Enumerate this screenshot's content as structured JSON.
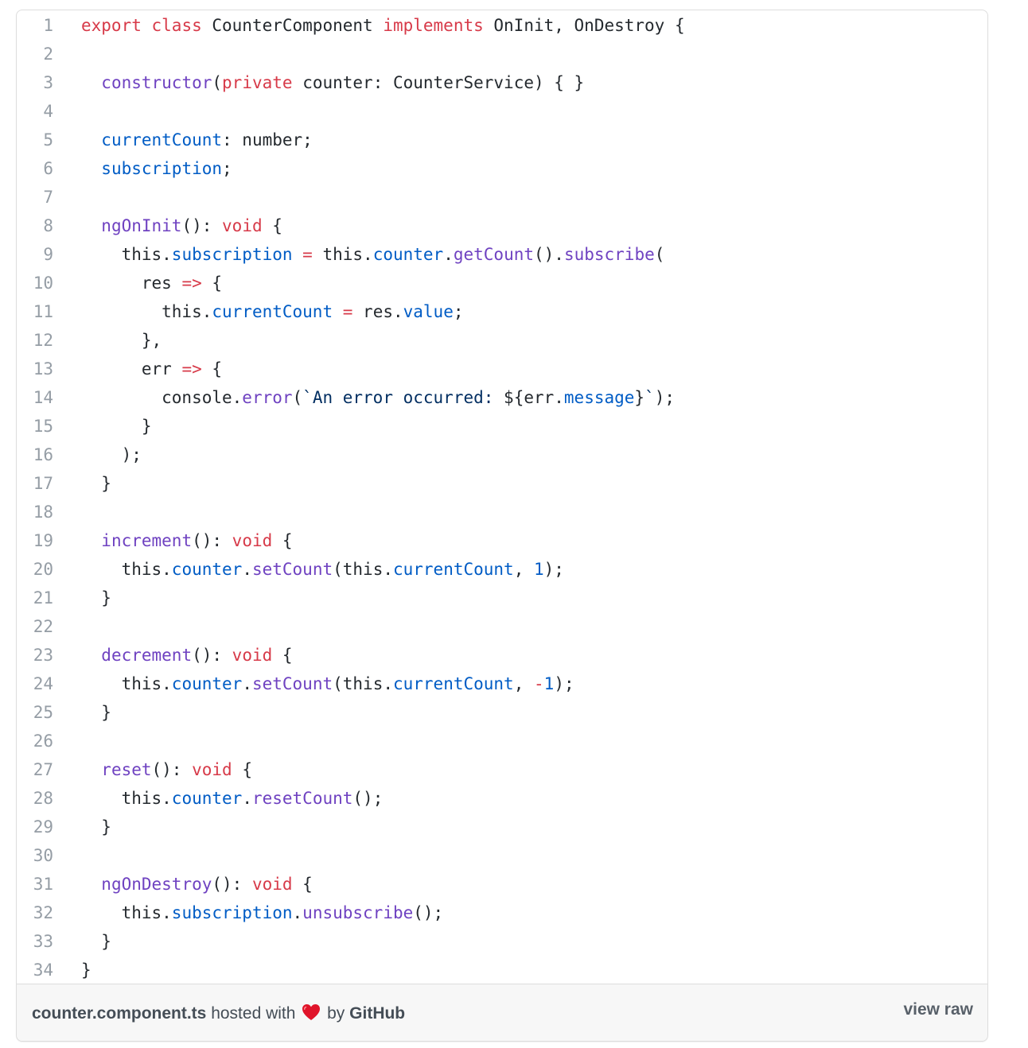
{
  "gist": {
    "filename": "counter.component.ts",
    "hosted_with": "hosted with",
    "by": "by",
    "host": "GitHub",
    "view_raw": "view raw"
  },
  "colors": {
    "keyword": "#d73a49",
    "function": "#6f42c1",
    "property": "#005cc5",
    "string": "#032f62",
    "text": "#24292e",
    "line_number": "#959da5"
  },
  "code_lines": [
    [
      [
        "k",
        "export"
      ],
      [
        "t",
        " "
      ],
      [
        "k",
        "class"
      ],
      [
        "t",
        " CounterComponent "
      ],
      [
        "k",
        "implements"
      ],
      [
        "t",
        " OnInit, OnDestroy {"
      ]
    ],
    [],
    [
      [
        "t",
        "  "
      ],
      [
        "f",
        "constructor"
      ],
      [
        "t",
        "("
      ],
      [
        "k",
        "private"
      ],
      [
        "t",
        " counter: CounterService) { }"
      ]
    ],
    [],
    [
      [
        "t",
        "  "
      ],
      [
        "p",
        "currentCount"
      ],
      [
        "t",
        ": number;"
      ]
    ],
    [
      [
        "t",
        "  "
      ],
      [
        "p",
        "subscription"
      ],
      [
        "t",
        ";"
      ]
    ],
    [],
    [
      [
        "t",
        "  "
      ],
      [
        "f",
        "ngOnInit"
      ],
      [
        "t",
        "(): "
      ],
      [
        "k",
        "void"
      ],
      [
        "t",
        " {"
      ]
    ],
    [
      [
        "t",
        "    this."
      ],
      [
        "p",
        "subscription"
      ],
      [
        "t",
        " "
      ],
      [
        "k",
        "="
      ],
      [
        "t",
        " this."
      ],
      [
        "p",
        "counter"
      ],
      [
        "t",
        "."
      ],
      [
        "f",
        "getCount"
      ],
      [
        "t",
        "()."
      ],
      [
        "f",
        "subscribe"
      ],
      [
        "t",
        "("
      ]
    ],
    [
      [
        "t",
        "      res "
      ],
      [
        "k",
        "=>"
      ],
      [
        "t",
        " {"
      ]
    ],
    [
      [
        "t",
        "        this."
      ],
      [
        "p",
        "currentCount"
      ],
      [
        "t",
        " "
      ],
      [
        "k",
        "="
      ],
      [
        "t",
        " res."
      ],
      [
        "p",
        "value"
      ],
      [
        "t",
        ";"
      ]
    ],
    [
      [
        "t",
        "      },"
      ]
    ],
    [
      [
        "t",
        "      err "
      ],
      [
        "k",
        "=>"
      ],
      [
        "t",
        " {"
      ]
    ],
    [
      [
        "t",
        "        console."
      ],
      [
        "f",
        "error"
      ],
      [
        "t",
        "("
      ],
      [
        "s",
        "`An error occurred: "
      ],
      [
        "t",
        "${err."
      ],
      [
        "p",
        "message"
      ],
      [
        "t",
        "}"
      ],
      [
        "s",
        "`"
      ],
      [
        "t",
        ");"
      ]
    ],
    [
      [
        "t",
        "      }"
      ]
    ],
    [
      [
        "t",
        "    );"
      ]
    ],
    [
      [
        "t",
        "  }"
      ]
    ],
    [],
    [
      [
        "t",
        "  "
      ],
      [
        "f",
        "increment"
      ],
      [
        "t",
        "(): "
      ],
      [
        "k",
        "void"
      ],
      [
        "t",
        " {"
      ]
    ],
    [
      [
        "t",
        "    this."
      ],
      [
        "p",
        "counter"
      ],
      [
        "t",
        "."
      ],
      [
        "f",
        "setCount"
      ],
      [
        "t",
        "(this."
      ],
      [
        "p",
        "currentCount"
      ],
      [
        "t",
        ", "
      ],
      [
        "p",
        "1"
      ],
      [
        "t",
        ");"
      ]
    ],
    [
      [
        "t",
        "  }"
      ]
    ],
    [],
    [
      [
        "t",
        "  "
      ],
      [
        "f",
        "decrement"
      ],
      [
        "t",
        "(): "
      ],
      [
        "k",
        "void"
      ],
      [
        "t",
        " {"
      ]
    ],
    [
      [
        "t",
        "    this."
      ],
      [
        "p",
        "counter"
      ],
      [
        "t",
        "."
      ],
      [
        "f",
        "setCount"
      ],
      [
        "t",
        "(this."
      ],
      [
        "p",
        "currentCount"
      ],
      [
        "t",
        ", "
      ],
      [
        "k",
        "-"
      ],
      [
        "p",
        "1"
      ],
      [
        "t",
        ");"
      ]
    ],
    [
      [
        "t",
        "  }"
      ]
    ],
    [],
    [
      [
        "t",
        "  "
      ],
      [
        "f",
        "reset"
      ],
      [
        "t",
        "(): "
      ],
      [
        "k",
        "void"
      ],
      [
        "t",
        " {"
      ]
    ],
    [
      [
        "t",
        "    this."
      ],
      [
        "p",
        "counter"
      ],
      [
        "t",
        "."
      ],
      [
        "f",
        "resetCount"
      ],
      [
        "t",
        "();"
      ]
    ],
    [
      [
        "t",
        "  }"
      ]
    ],
    [],
    [
      [
        "t",
        "  "
      ],
      [
        "f",
        "ngOnDestroy"
      ],
      [
        "t",
        "(): "
      ],
      [
        "k",
        "void"
      ],
      [
        "t",
        " {"
      ]
    ],
    [
      [
        "t",
        "    this."
      ],
      [
        "p",
        "subscription"
      ],
      [
        "t",
        "."
      ],
      [
        "f",
        "unsubscribe"
      ],
      [
        "t",
        "();"
      ]
    ],
    [
      [
        "t",
        "  }"
      ]
    ],
    [
      [
        "t",
        "}"
      ]
    ]
  ]
}
